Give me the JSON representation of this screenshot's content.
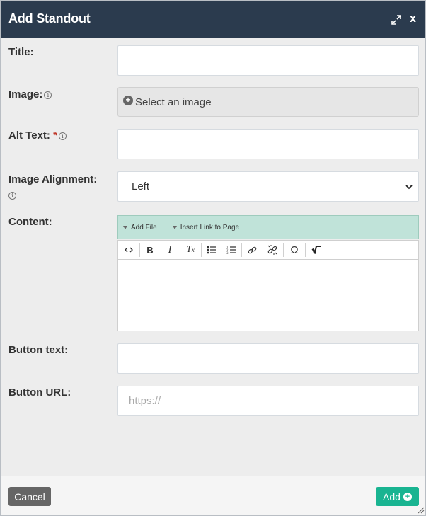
{
  "dialog": {
    "title": "Add Standout",
    "close_label": "x",
    "expand_icon": "expand-arrows-icon"
  },
  "form": {
    "title_label": "Title:",
    "title_value": "",
    "image_label": "Image:",
    "image_button": "Select an image",
    "alt_text_label": "Alt Text:",
    "alt_text_required_mark": "*",
    "alt_text_value": "",
    "alignment_label": "Image Alignment:",
    "alignment_selected": "Left",
    "content_label": "Content:",
    "content_toolbar": {
      "add_file": "Add File",
      "insert_link": "Insert Link to Page"
    },
    "editor_tools": [
      {
        "name": "source-code-icon",
        "glyph": "‹›"
      },
      {
        "name": "bold-icon",
        "glyph": "B"
      },
      {
        "name": "italic-icon",
        "glyph": "I"
      },
      {
        "name": "remove-format-icon",
        "glyph": "Tx"
      },
      {
        "name": "bulleted-list-icon",
        "glyph": "•≡"
      },
      {
        "name": "numbered-list-icon",
        "glyph": "1≡"
      },
      {
        "name": "link-icon",
        "glyph": "🔗"
      },
      {
        "name": "unlink-icon",
        "glyph": "⛓"
      },
      {
        "name": "special-character-icon",
        "glyph": "Ω"
      },
      {
        "name": "math-icon",
        "glyph": "√"
      }
    ],
    "button_text_label": "Button text:",
    "button_text_value": "",
    "button_url_label": "Button URL:",
    "button_url_placeholder": "https://"
  },
  "footer": {
    "cancel": "Cancel",
    "add": "Add"
  },
  "colors": {
    "header": "#2b3b4e",
    "add_button": "#19b491",
    "cancel_button": "#666666",
    "content_toolbar": "#c0e3d9",
    "required": "#c0392b"
  }
}
